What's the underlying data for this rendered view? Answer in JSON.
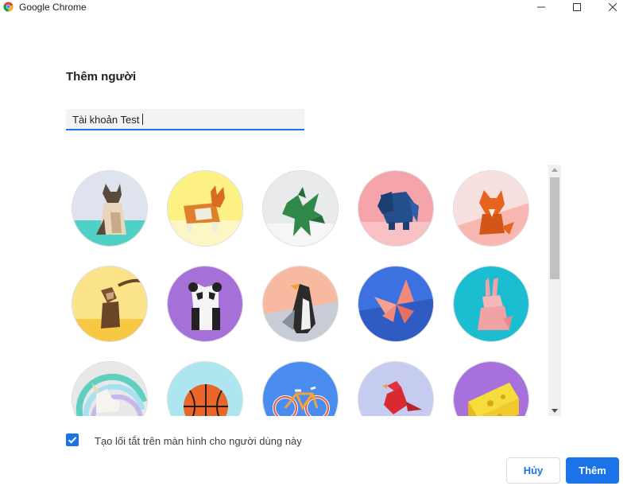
{
  "window": {
    "app_title": "Google Chrome",
    "controls": [
      "minimize-icon",
      "maximize-icon",
      "close-icon"
    ]
  },
  "dialog": {
    "title": "Thêm người",
    "name_input_value": "Tài khoản Test",
    "checkbox_label": "Tạo lối tắt trên màn hình cho người dùng này",
    "checkbox_checked": true,
    "cancel_label": "Hủy",
    "add_label": "Thêm"
  },
  "avatars": [
    {
      "name": "cat",
      "bg": "#dfe3ee"
    },
    {
      "name": "corgi",
      "bg": "#fdf183"
    },
    {
      "name": "dragon",
      "bg": "#e9eaeb"
    },
    {
      "name": "elephant",
      "bg": "#f5a4a9"
    },
    {
      "name": "fox",
      "bg": "#f8dfe0"
    },
    {
      "name": "monkey",
      "bg": "#fbe38a"
    },
    {
      "name": "panda",
      "bg": "#a570d8"
    },
    {
      "name": "penguin",
      "bg": "#f7b9a0"
    },
    {
      "name": "butterfly",
      "bg": "#3c72e0"
    },
    {
      "name": "rabbit",
      "bg": "#1bbdd0"
    },
    {
      "name": "unicorn",
      "bg": "#e8e8e8"
    },
    {
      "name": "basketball",
      "bg": "#aee6ef"
    },
    {
      "name": "bike",
      "bg": "#4a8cf0"
    },
    {
      "name": "bird",
      "bg": "#c6cbf0"
    },
    {
      "name": "cheese",
      "bg": "#a770dc"
    }
  ],
  "colors": {
    "accent": "#1a73e8",
    "field_bg": "#f1f3f4",
    "border": "#dadce0"
  }
}
